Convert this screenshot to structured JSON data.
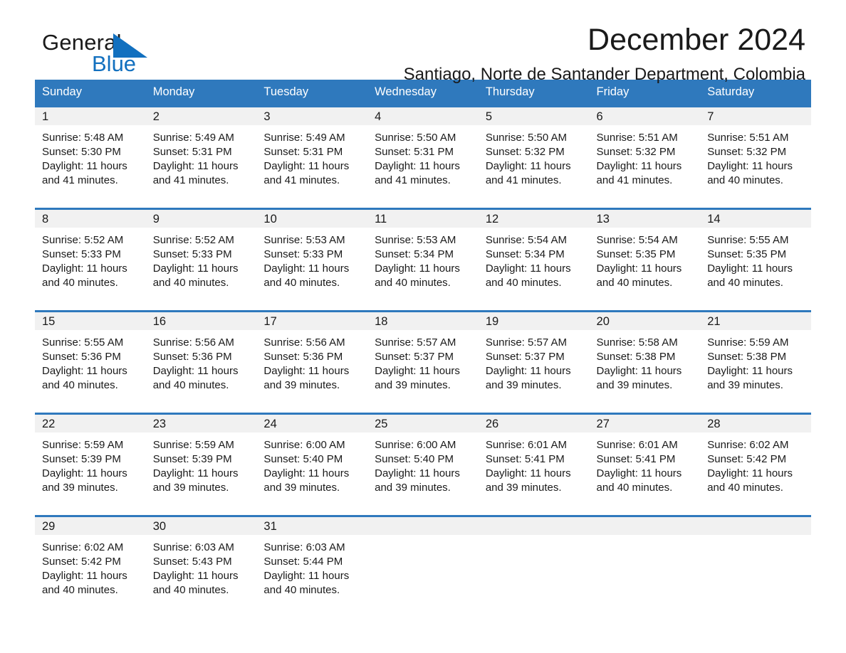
{
  "brand": {
    "name_part1": "General",
    "name_part2": "Blue",
    "logo_icon": "triangle-logo-icon",
    "accent_color": "#1270bf"
  },
  "header": {
    "title": "December 2024",
    "subtitle": "Santiago, Norte de Santander Department, Colombia"
  },
  "colors": {
    "header_blue": "#2f79bd",
    "daynum_gray": "#f1f1f1",
    "text": "#1a1a1a"
  },
  "weekday_headers": [
    "Sunday",
    "Monday",
    "Tuesday",
    "Wednesday",
    "Thursday",
    "Friday",
    "Saturday"
  ],
  "weeks": [
    [
      {
        "day": "1",
        "sunrise": "Sunrise: 5:48 AM",
        "sunset": "Sunset: 5:30 PM",
        "daylight_line1": "Daylight: 11 hours",
        "daylight_line2": "and 41 minutes."
      },
      {
        "day": "2",
        "sunrise": "Sunrise: 5:49 AM",
        "sunset": "Sunset: 5:31 PM",
        "daylight_line1": "Daylight: 11 hours",
        "daylight_line2": "and 41 minutes."
      },
      {
        "day": "3",
        "sunrise": "Sunrise: 5:49 AM",
        "sunset": "Sunset: 5:31 PM",
        "daylight_line1": "Daylight: 11 hours",
        "daylight_line2": "and 41 minutes."
      },
      {
        "day": "4",
        "sunrise": "Sunrise: 5:50 AM",
        "sunset": "Sunset: 5:31 PM",
        "daylight_line1": "Daylight: 11 hours",
        "daylight_line2": "and 41 minutes."
      },
      {
        "day": "5",
        "sunrise": "Sunrise: 5:50 AM",
        "sunset": "Sunset: 5:32 PM",
        "daylight_line1": "Daylight: 11 hours",
        "daylight_line2": "and 41 minutes."
      },
      {
        "day": "6",
        "sunrise": "Sunrise: 5:51 AM",
        "sunset": "Sunset: 5:32 PM",
        "daylight_line1": "Daylight: 11 hours",
        "daylight_line2": "and 41 minutes."
      },
      {
        "day": "7",
        "sunrise": "Sunrise: 5:51 AM",
        "sunset": "Sunset: 5:32 PM",
        "daylight_line1": "Daylight: 11 hours",
        "daylight_line2": "and 40 minutes."
      }
    ],
    [
      {
        "day": "8",
        "sunrise": "Sunrise: 5:52 AM",
        "sunset": "Sunset: 5:33 PM",
        "daylight_line1": "Daylight: 11 hours",
        "daylight_line2": "and 40 minutes."
      },
      {
        "day": "9",
        "sunrise": "Sunrise: 5:52 AM",
        "sunset": "Sunset: 5:33 PM",
        "daylight_line1": "Daylight: 11 hours",
        "daylight_line2": "and 40 minutes."
      },
      {
        "day": "10",
        "sunrise": "Sunrise: 5:53 AM",
        "sunset": "Sunset: 5:33 PM",
        "daylight_line1": "Daylight: 11 hours",
        "daylight_line2": "and 40 minutes."
      },
      {
        "day": "11",
        "sunrise": "Sunrise: 5:53 AM",
        "sunset": "Sunset: 5:34 PM",
        "daylight_line1": "Daylight: 11 hours",
        "daylight_line2": "and 40 minutes."
      },
      {
        "day": "12",
        "sunrise": "Sunrise: 5:54 AM",
        "sunset": "Sunset: 5:34 PM",
        "daylight_line1": "Daylight: 11 hours",
        "daylight_line2": "and 40 minutes."
      },
      {
        "day": "13",
        "sunrise": "Sunrise: 5:54 AM",
        "sunset": "Sunset: 5:35 PM",
        "daylight_line1": "Daylight: 11 hours",
        "daylight_line2": "and 40 minutes."
      },
      {
        "day": "14",
        "sunrise": "Sunrise: 5:55 AM",
        "sunset": "Sunset: 5:35 PM",
        "daylight_line1": "Daylight: 11 hours",
        "daylight_line2": "and 40 minutes."
      }
    ],
    [
      {
        "day": "15",
        "sunrise": "Sunrise: 5:55 AM",
        "sunset": "Sunset: 5:36 PM",
        "daylight_line1": "Daylight: 11 hours",
        "daylight_line2": "and 40 minutes."
      },
      {
        "day": "16",
        "sunrise": "Sunrise: 5:56 AM",
        "sunset": "Sunset: 5:36 PM",
        "daylight_line1": "Daylight: 11 hours",
        "daylight_line2": "and 40 minutes."
      },
      {
        "day": "17",
        "sunrise": "Sunrise: 5:56 AM",
        "sunset": "Sunset: 5:36 PM",
        "daylight_line1": "Daylight: 11 hours",
        "daylight_line2": "and 39 minutes."
      },
      {
        "day": "18",
        "sunrise": "Sunrise: 5:57 AM",
        "sunset": "Sunset: 5:37 PM",
        "daylight_line1": "Daylight: 11 hours",
        "daylight_line2": "and 39 minutes."
      },
      {
        "day": "19",
        "sunrise": "Sunrise: 5:57 AM",
        "sunset": "Sunset: 5:37 PM",
        "daylight_line1": "Daylight: 11 hours",
        "daylight_line2": "and 39 minutes."
      },
      {
        "day": "20",
        "sunrise": "Sunrise: 5:58 AM",
        "sunset": "Sunset: 5:38 PM",
        "daylight_line1": "Daylight: 11 hours",
        "daylight_line2": "and 39 minutes."
      },
      {
        "day": "21",
        "sunrise": "Sunrise: 5:59 AM",
        "sunset": "Sunset: 5:38 PM",
        "daylight_line1": "Daylight: 11 hours",
        "daylight_line2": "and 39 minutes."
      }
    ],
    [
      {
        "day": "22",
        "sunrise": "Sunrise: 5:59 AM",
        "sunset": "Sunset: 5:39 PM",
        "daylight_line1": "Daylight: 11 hours",
        "daylight_line2": "and 39 minutes."
      },
      {
        "day": "23",
        "sunrise": "Sunrise: 5:59 AM",
        "sunset": "Sunset: 5:39 PM",
        "daylight_line1": "Daylight: 11 hours",
        "daylight_line2": "and 39 minutes."
      },
      {
        "day": "24",
        "sunrise": "Sunrise: 6:00 AM",
        "sunset": "Sunset: 5:40 PM",
        "daylight_line1": "Daylight: 11 hours",
        "daylight_line2": "and 39 minutes."
      },
      {
        "day": "25",
        "sunrise": "Sunrise: 6:00 AM",
        "sunset": "Sunset: 5:40 PM",
        "daylight_line1": "Daylight: 11 hours",
        "daylight_line2": "and 39 minutes."
      },
      {
        "day": "26",
        "sunrise": "Sunrise: 6:01 AM",
        "sunset": "Sunset: 5:41 PM",
        "daylight_line1": "Daylight: 11 hours",
        "daylight_line2": "and 39 minutes."
      },
      {
        "day": "27",
        "sunrise": "Sunrise: 6:01 AM",
        "sunset": "Sunset: 5:41 PM",
        "daylight_line1": "Daylight: 11 hours",
        "daylight_line2": "and 40 minutes."
      },
      {
        "day": "28",
        "sunrise": "Sunrise: 6:02 AM",
        "sunset": "Sunset: 5:42 PM",
        "daylight_line1": "Daylight: 11 hours",
        "daylight_line2": "and 40 minutes."
      }
    ],
    [
      {
        "day": "29",
        "sunrise": "Sunrise: 6:02 AM",
        "sunset": "Sunset: 5:42 PM",
        "daylight_line1": "Daylight: 11 hours",
        "daylight_line2": "and 40 minutes."
      },
      {
        "day": "30",
        "sunrise": "Sunrise: 6:03 AM",
        "sunset": "Sunset: 5:43 PM",
        "daylight_line1": "Daylight: 11 hours",
        "daylight_line2": "and 40 minutes."
      },
      {
        "day": "31",
        "sunrise": "Sunrise: 6:03 AM",
        "sunset": "Sunset: 5:44 PM",
        "daylight_line1": "Daylight: 11 hours",
        "daylight_line2": "and 40 minutes."
      },
      null,
      null,
      null,
      null
    ]
  ]
}
